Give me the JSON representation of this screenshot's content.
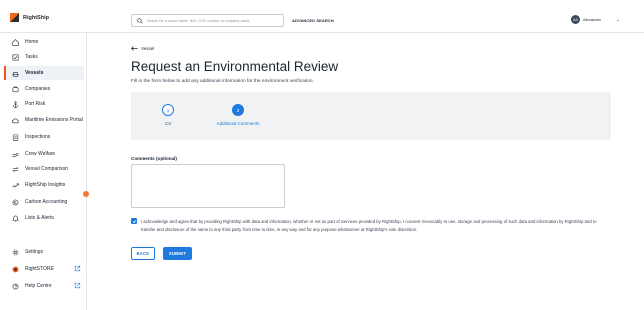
{
  "brand": {
    "name": "RightShip"
  },
  "header": {
    "search_placeholder": "Search for a vessel name, IMO, DOC number or company name",
    "advanced_search": "ADVANCED SEARCH",
    "user_initials": "AS",
    "user_name": "Alexander"
  },
  "sidebar": {
    "items": [
      {
        "label": "Home",
        "icon": "home-icon"
      },
      {
        "label": "Tasks",
        "icon": "tasks-icon"
      },
      {
        "label": "Vessels",
        "icon": "ship-icon",
        "active": true
      },
      {
        "label": "Companies",
        "icon": "companies-icon"
      },
      {
        "label": "Port Risk",
        "icon": "anchor-icon"
      },
      {
        "label": "Maritime Emissions Portal",
        "icon": "cloud-icon"
      },
      {
        "label": "Inspections",
        "icon": "inspections-icon"
      },
      {
        "label": "Crew Welfare",
        "icon": "crew-icon"
      },
      {
        "label": "Vessel Comparison",
        "icon": "compare-icon"
      },
      {
        "label": "RightShip Insights",
        "icon": "insights-icon"
      },
      {
        "label": "Carbon Accounting",
        "icon": "carbon-icon"
      },
      {
        "label": "Lists & Alerts",
        "icon": "lists-icon"
      }
    ],
    "bottom_items": [
      {
        "label": "Settings",
        "icon": "gear-icon"
      },
      {
        "label": "RightSTORE",
        "icon": "store-icon",
        "external": true
      },
      {
        "label": "Help Centre",
        "icon": "help-icon",
        "external": true
      }
    ]
  },
  "main": {
    "back_link": "Vessel",
    "title": "Request an Environmental Review",
    "subtitle": "Fill in the form below to add any additional information for the environment verification.",
    "steps": [
      {
        "number": "1",
        "label": "CII",
        "state": "outline"
      },
      {
        "number": "2",
        "label": "Additional Comments",
        "state": "active"
      }
    ],
    "comments_label": "Comments (optional)",
    "comments_value": "",
    "acknowledgement": "I acknowledge and agree that by providing RightShip with data and information, whether or not as part of Services provided by RightShip, I consent irrevocably to use, storage and processing of such data and information by RightShip and to transfer and disclosure of the same to any third party from time to time, in any way and for any purpose whatsoever at RightShip's sole discretion.",
    "acknowledged": true,
    "back_button": "BACK",
    "submit_button": "SUBMIT"
  },
  "colors": {
    "accent": "#1f7ae0",
    "brand": "#e8571e"
  }
}
